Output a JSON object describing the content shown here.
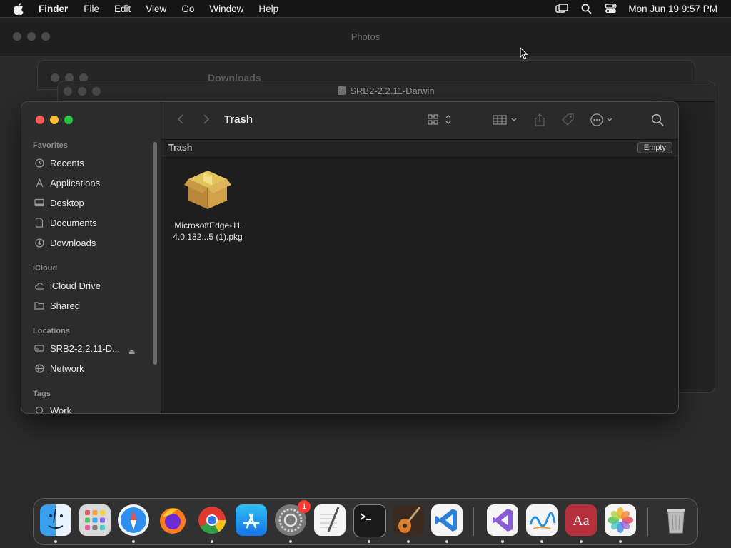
{
  "menubar": {
    "app": "Finder",
    "menus": [
      "File",
      "Edit",
      "View",
      "Go",
      "Window",
      "Help"
    ],
    "clock": "Mon Jun 19  9:57 PM"
  },
  "windows": {
    "photos_title": "Photos",
    "downloads_title": "Downloads",
    "srb_title": "SRB2-2.2.11-Darwin"
  },
  "finder": {
    "title": "Trash",
    "path_label": "Trash",
    "empty_button": "Empty",
    "sidebar": {
      "favorites_header": "Favorites",
      "favorites": [
        "Recents",
        "Applications",
        "Desktop",
        "Documents",
        "Downloads"
      ],
      "icloud_header": "iCloud",
      "icloud": [
        "iCloud Drive",
        "Shared"
      ],
      "locations_header": "Locations",
      "locations": [
        "SRB2-2.2.11-D...",
        "Network"
      ],
      "tags_header": "Tags",
      "tags": [
        "Work"
      ]
    },
    "files": [
      {
        "name_line1": "MicrosoftEdge-11",
        "name_line2": "4.0.182...5 (1).pkg",
        "icon": "package-icon"
      }
    ]
  },
  "dock": {
    "apps": [
      "Finder",
      "Launchpad",
      "Safari",
      "Firefox",
      "Chrome",
      "App Store",
      "System Settings",
      "TextEdit",
      "Terminal",
      "GarageBand",
      "VS Code",
      "Visual Studio",
      "Freeform",
      "Dictionary",
      "Photos",
      "Trash"
    ],
    "settings_badge": "1"
  }
}
